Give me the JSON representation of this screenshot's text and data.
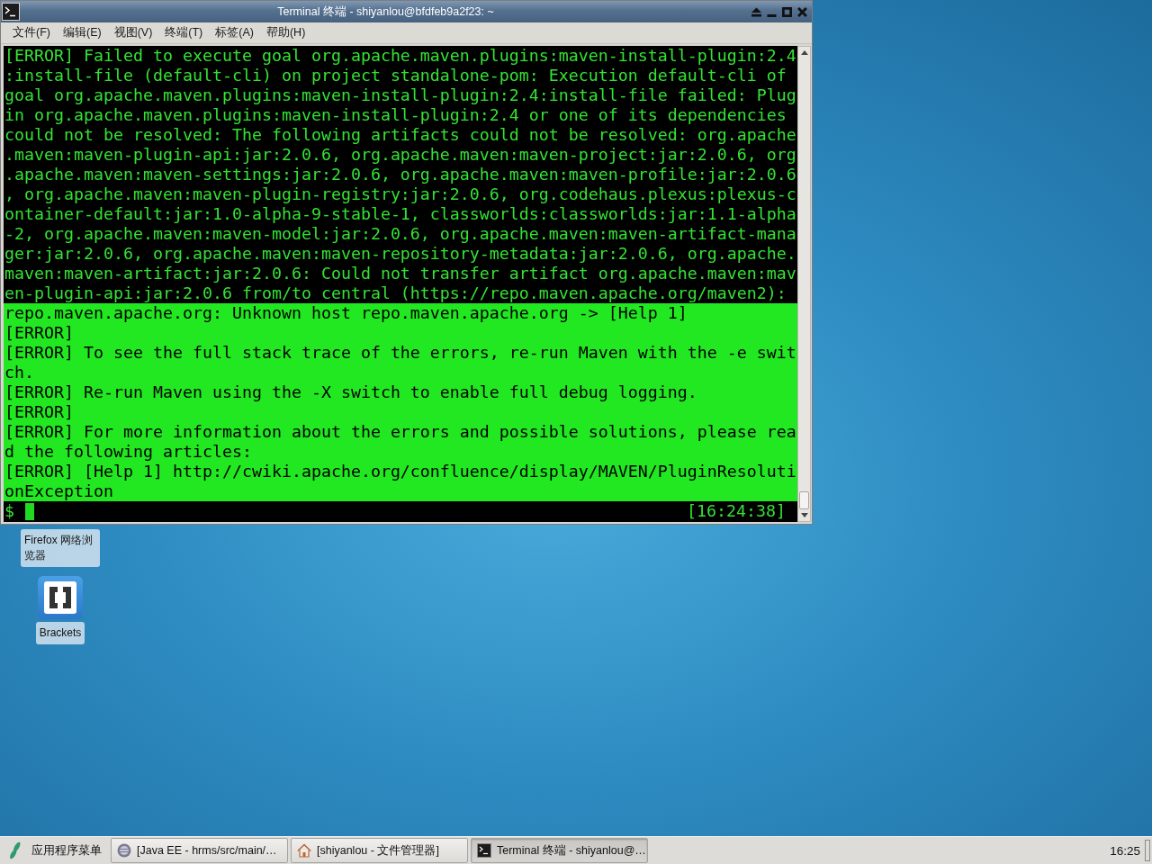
{
  "window": {
    "title": "Terminal 终端 - shiyanlou@bfdfeb9a2f23: ~",
    "menu": [
      "文件(F)",
      "编辑(E)",
      "视图(V)",
      "终端(T)",
      "标签(A)",
      "帮助(H)"
    ]
  },
  "terminal": {
    "lines": [
      {
        "text": "[ERROR] Failed to execute goal org.apache.maven.plugins:maven-install-plugin:2.4",
        "selected": false
      },
      {
        "text": ":install-file (default-cli) on project standalone-pom: Execution default-cli of",
        "selected": false
      },
      {
        "text": "goal org.apache.maven.plugins:maven-install-plugin:2.4:install-file failed: Plug",
        "selected": false
      },
      {
        "text": "in org.apache.maven.plugins:maven-install-plugin:2.4 or one of its dependencies",
        "selected": false
      },
      {
        "text": "could not be resolved: The following artifacts could not be resolved: org.apache",
        "selected": false
      },
      {
        "text": ".maven:maven-plugin-api:jar:2.0.6, org.apache.maven:maven-project:jar:2.0.6, org",
        "selected": false
      },
      {
        "text": ".apache.maven:maven-settings:jar:2.0.6, org.apache.maven:maven-profile:jar:2.0.6",
        "selected": false
      },
      {
        "text": ", org.apache.maven:maven-plugin-registry:jar:2.0.6, org.codehaus.plexus:plexus-c",
        "selected": false
      },
      {
        "text": "ontainer-default:jar:1.0-alpha-9-stable-1, classworlds:classworlds:jar:1.1-alpha",
        "selected": false
      },
      {
        "text": "-2, org.apache.maven:maven-model:jar:2.0.6, org.apache.maven:maven-artifact-mana",
        "selected": false
      },
      {
        "text": "ger:jar:2.0.6, org.apache.maven:maven-repository-metadata:jar:2.0.6, org.apache.",
        "selected": false
      },
      {
        "text": "maven:maven-artifact:jar:2.0.6: Could not transfer artifact org.apache.maven:mav",
        "selected": false
      },
      {
        "text": "en-plugin-api:jar:2.0.6 from/to central (https://repo.maven.apache.org/maven2):",
        "selected": false
      },
      {
        "text": "repo.maven.apache.org: Unknown host repo.maven.apache.org -> [Help 1]",
        "selected": true
      },
      {
        "text": "[ERROR]",
        "selected": true
      },
      {
        "text": "[ERROR] To see the full stack trace of the errors, re-run Maven with the -e swit",
        "selected": true
      },
      {
        "text": "ch.",
        "selected": true
      },
      {
        "text": "[ERROR] Re-run Maven using the -X switch to enable full debug logging.",
        "selected": true
      },
      {
        "text": "[ERROR]",
        "selected": true
      },
      {
        "text": "[ERROR] For more information about the errors and possible solutions, please rea",
        "selected": true
      },
      {
        "text": "d the following articles:",
        "selected": true
      },
      {
        "text": "[ERROR] [Help 1] http://cwiki.apache.org/confluence/display/MAVEN/PluginResoluti",
        "selected": true
      },
      {
        "text": "onException",
        "selected": true
      }
    ],
    "prompt": "$",
    "clock": "[16:24:38]"
  },
  "desktop_icons": [
    {
      "label": "Firefox 网络浏览器",
      "kind": "label"
    },
    {
      "label": "Brackets",
      "kind": "brackets"
    }
  ],
  "taskbar": {
    "menu_button": "应用程序菜单",
    "tasks": [
      {
        "label": "[Java EE - hrms/src/main/…",
        "kind": "ide",
        "selected": false
      },
      {
        "label": "[shiyanlou - 文件管理器]",
        "kind": "files",
        "selected": false
      },
      {
        "label": "Terminal 终端 - shiyanlou@…",
        "kind": "terminal",
        "selected": true
      }
    ],
    "clock": "16:25"
  }
}
